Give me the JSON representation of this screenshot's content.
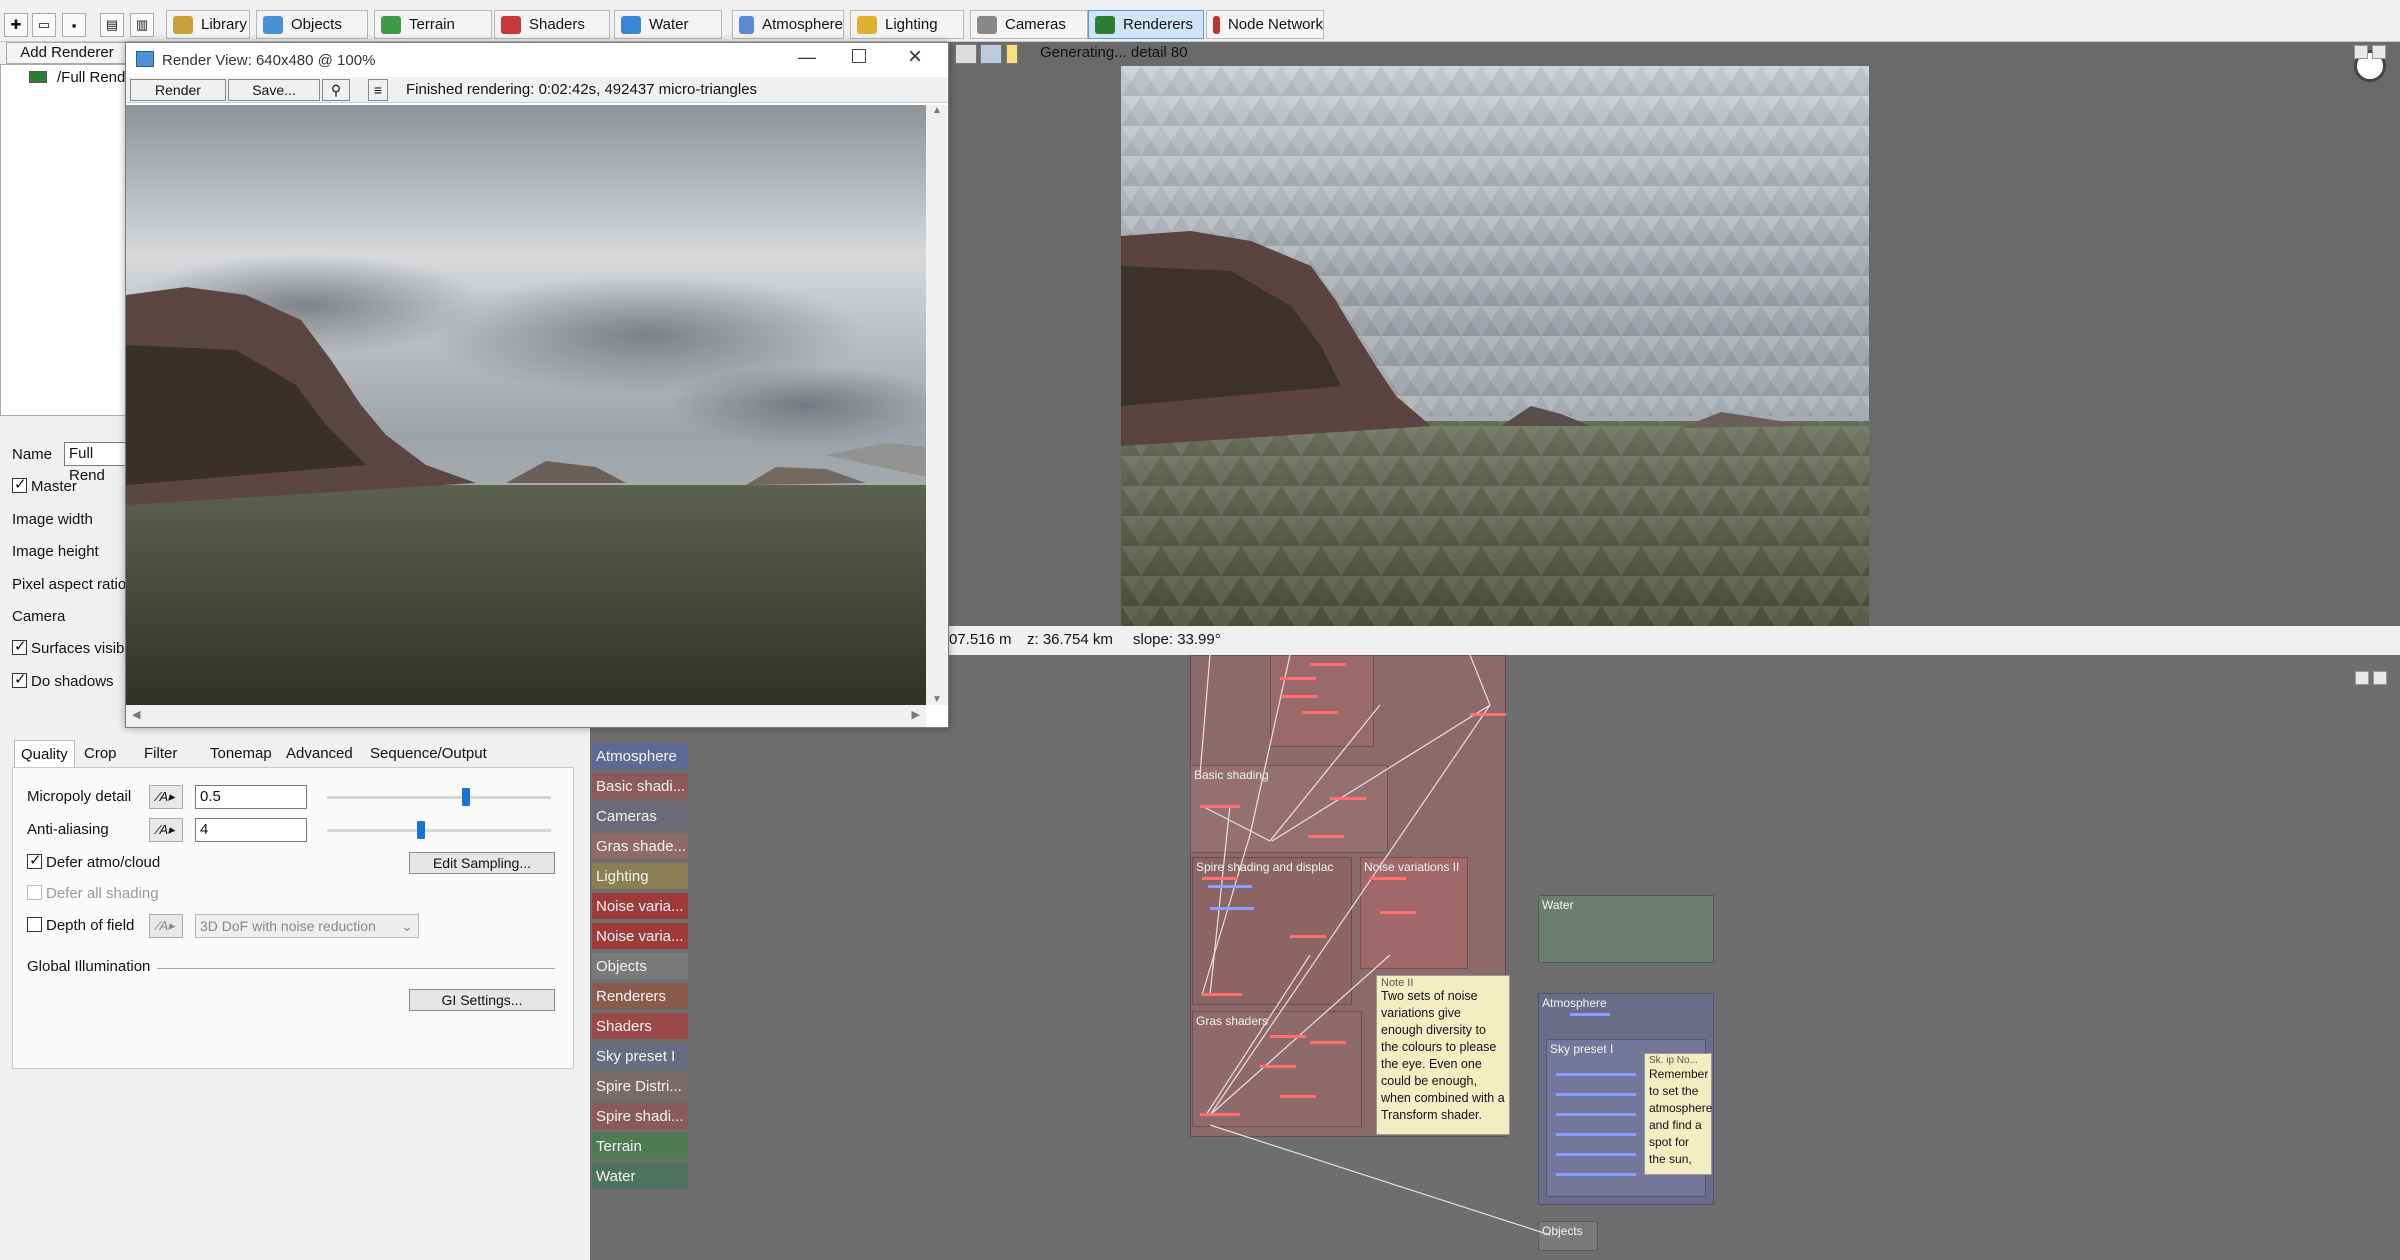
{
  "toolbar": {
    "buttons": [
      {
        "label": "Library",
        "icon": "library-icon"
      },
      {
        "label": "Objects",
        "icon": "objects-icon"
      },
      {
        "label": "Terrain",
        "icon": "terrain-icon"
      },
      {
        "label": "Shaders",
        "icon": "shaders-icon"
      },
      {
        "label": "Water",
        "icon": "water-icon"
      },
      {
        "label": "Atmosphere",
        "icon": "atmosphere-icon"
      },
      {
        "label": "Lighting",
        "icon": "lighting-icon"
      },
      {
        "label": "Cameras",
        "icon": "cameras-icon"
      },
      {
        "label": "Renderers",
        "icon": "renderers-icon"
      },
      {
        "label": "Node Network",
        "icon": "node-network-icon"
      }
    ],
    "active": "Renderers"
  },
  "left": {
    "add_renderer": "Add Renderer",
    "tree_item": "/Full Rend",
    "name_label": "Name",
    "name_value": "Full Rend",
    "master_label": "Master",
    "image_width_label": "Image width",
    "image_height_label": "Image height",
    "pixel_aspect_label": "Pixel aspect ratio",
    "camera_label": "Camera",
    "surfaces_visible_label": "Surfaces visibl",
    "do_shadows_label": "Do shadows"
  },
  "tabs": [
    "Quality",
    "Crop",
    "Filter",
    "Tonemap",
    "Advanced",
    "Sequence/Output"
  ],
  "quality": {
    "micropoly_label": "Micropoly detail",
    "micropoly_value": "0.5",
    "micropoly_fraction": 0.62,
    "antialias_label": "Anti-aliasing",
    "antialias_value": "4",
    "antialias_fraction": 0.42,
    "edit_sampling": "Edit Sampling...",
    "defer_atmo": "Defer atmo/cloud",
    "defer_all": "Defer all shading",
    "dof_label": "Depth of field",
    "dof_option": "3D DoF with noise reduction",
    "gi_label": "Global Illumination",
    "gi_settings": "GI Settings..."
  },
  "render_view": {
    "title": "Render View: 640x480 @ 100%",
    "render_btn": "Render",
    "save_btn": "Save...",
    "status": "Finished rendering:  0:02:42s, 492437 micro-triangles"
  },
  "viewport": {
    "generating": "Generating... detail 80",
    "status_y": "07.516 m",
    "status_z": "z: 36.754 km",
    "status_slope": "slope: 33.99°"
  },
  "node_categories": [
    {
      "label": "Atmosphere",
      "color": "#5d6a95"
    },
    {
      "label": "Basic shadi...",
      "color": "#8c5a5a"
    },
    {
      "label": "Cameras",
      "color": "#6a6a78"
    },
    {
      "label": "Gras shade...",
      "color": "#8e6a6a"
    },
    {
      "label": "Lighting",
      "color": "#8a7e52"
    },
    {
      "label": "Noise varia...",
      "color": "#9e3a3a"
    },
    {
      "label": "Noise varia...",
      "color": "#9e3a3a"
    },
    {
      "label": "Objects",
      "color": "#7a7a7a"
    },
    {
      "label": "Renderers",
      "color": "#8a5a4a"
    },
    {
      "label": "Shaders",
      "color": "#9a4848"
    },
    {
      "label": "Sky preset I",
      "color": "#6a6a82"
    },
    {
      "label": "Spire Distri...",
      "color": "#7a6a6a"
    },
    {
      "label": "Spire shadi...",
      "color": "#8a5a5a"
    },
    {
      "label": "Terrain",
      "color": "#4f7a52"
    },
    {
      "label": "Water",
      "color": "#4e7260"
    }
  ],
  "node_groups": {
    "basic_shading": "Basic shading",
    "spire": "Spire shading and displac",
    "noise2": "Noise variations II",
    "gras": "Gras shaders",
    "water": "Water",
    "atmosphere": "Atmosphere",
    "sky": "Sky preset I",
    "objects": "Objects",
    "note_title": "Note II",
    "note_text": "Two sets of noise variations give enough diversity to the colours to please the eye. Even one could be enough, when combined with a Transform shader.",
    "sky_note_title": "Sk. ip No...",
    "sky_note_text": "Remember to set the atmosphere and find a spot for the sun,"
  }
}
